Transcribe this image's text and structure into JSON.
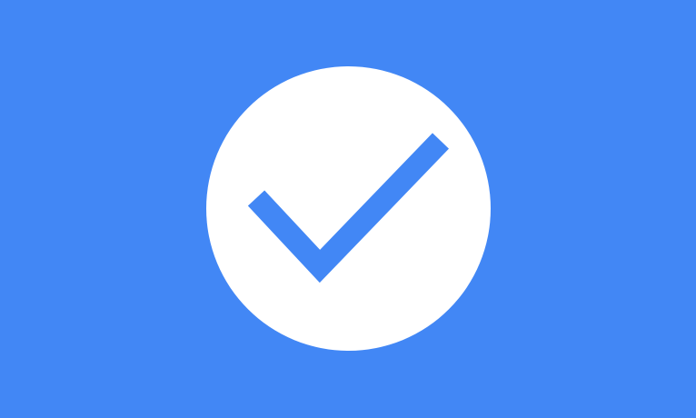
{
  "colors": {
    "background": "#4287F5",
    "badge_fill": "#FFFFFF",
    "check_stroke": "#4287F5"
  },
  "icon": {
    "name": "check-circle-icon",
    "state": "success"
  }
}
